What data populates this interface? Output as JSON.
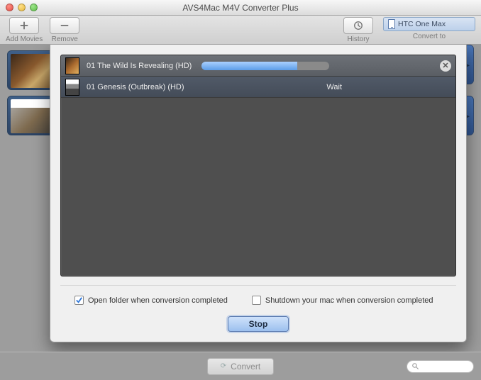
{
  "titlebar": {
    "title": "AVS4Mac M4V Converter Plus"
  },
  "toolbar": {
    "add_label": "Add Movies",
    "remove_label": "Remove",
    "history_label": "History",
    "convert_to_label": "Convert to",
    "convert_target": "HTC One Max"
  },
  "queue": {
    "items": [
      {
        "title": "01 The Wild Is Revealing (HD)",
        "status": "converting",
        "progress_pct": 75
      },
      {
        "title": "01 Genesis (Outbreak) (HD)",
        "status": "Wait"
      }
    ]
  },
  "options": {
    "open_folder_label": "Open folder when conversion completed",
    "open_folder_checked": true,
    "shutdown_label": "Shutdown your mac when conversion completed",
    "shutdown_checked": false
  },
  "actions": {
    "stop_label": "Stop",
    "convert_label": "Convert"
  },
  "search": {
    "placeholder": ""
  }
}
